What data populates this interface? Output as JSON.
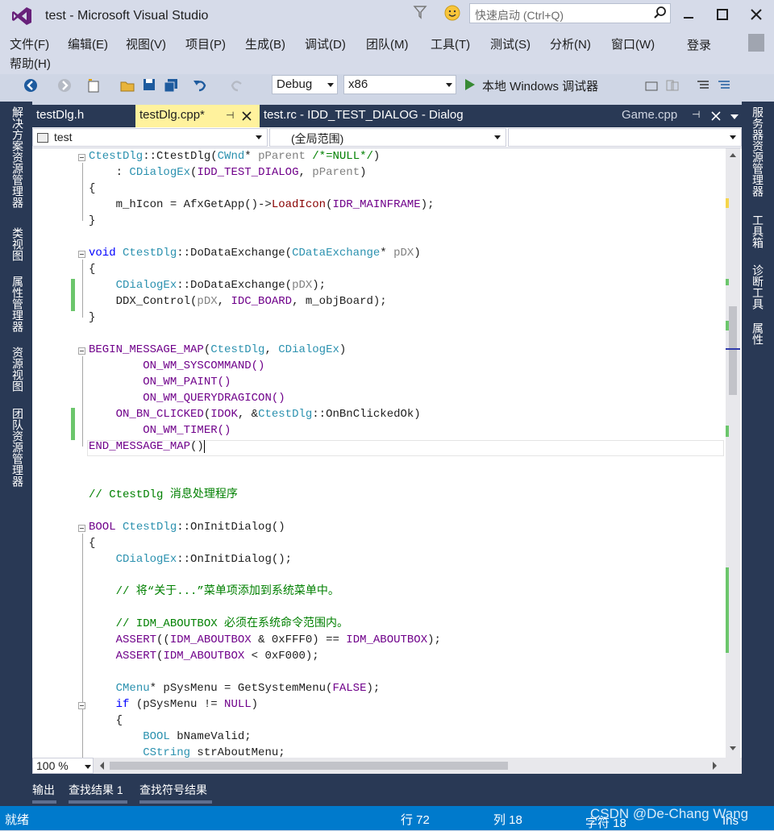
{
  "window": {
    "title": "test - Microsoft Visual Studio",
    "quick_launch_placeholder": "快速启动 (Ctrl+Q)",
    "login": "登录"
  },
  "menu": [
    "文件(F)",
    "编辑(E)",
    "视图(V)",
    "项目(P)",
    "生成(B)",
    "调试(D)",
    "团队(M)",
    "工具(T)",
    "测试(S)",
    "分析(N)",
    "窗口(W)",
    "帮助(H)"
  ],
  "toolbar": {
    "config": "Debug",
    "platform": "x86",
    "debugger": "本地 Windows 调试器"
  },
  "left_rail": [
    "解决方案资源管理器",
    "类视图",
    "属性管理器",
    "资源视图",
    "团队资源管理器"
  ],
  "right_rail": [
    "服务器资源管理器",
    "工具箱",
    "诊断工具",
    "属性"
  ],
  "tabs": [
    "testDlg.h",
    "testDlg.cpp*",
    "test.rc - IDD_TEST_DIALOG - Dialog",
    "Game.cpp"
  ],
  "nav": {
    "project": "test",
    "scope": "(全局范围)",
    "member": ""
  },
  "zoom": "100 %",
  "bottom_tabs": [
    "输出",
    "查找结果 1",
    "查找符号结果"
  ],
  "status": {
    "ready": "就绪",
    "line": "行 72",
    "col": "列 18",
    "char": "字符 18",
    "mode": "Ins",
    "watermark": "CSDN @De-Chang Wang"
  },
  "code": [
    "CtestDlg::CtestDlg(CWnd* pParent /*=NULL*/)",
    "    : CDialogEx(IDD_TEST_DIALOG, pParent)",
    "{",
    "    m_hIcon = AfxGetApp()->LoadIcon(IDR_MAINFRAME);",
    "}",
    "",
    "void CtestDlg::DoDataExchange(CDataExchange* pDX)",
    "{",
    "    CDialogEx::DoDataExchange(pDX);",
    "    DDX_Control(pDX, IDC_BOARD, m_objBoard);",
    "}",
    "",
    "BEGIN_MESSAGE_MAP(CtestDlg, CDialogEx)",
    "    ON_WM_SYSCOMMAND()",
    "    ON_WM_PAINT()",
    "    ON_WM_QUERYDRAGICON()",
    "    ON_BN_CLICKED(IDOK, &CtestDlg::OnBnClickedOk)",
    "    ON_WM_TIMER()",
    "END_MESSAGE_MAP()",
    "",
    "",
    "// CtestDlg 消息处理程序",
    "",
    "BOOL CtestDlg::OnInitDialog()",
    "{",
    "    CDialogEx::OnInitDialog();",
    "",
    "    // 将“关于...”菜单项添加到系统菜单中。",
    "",
    "    // IDM_ABOUTBOX 必须在系统命令范围内。",
    "    ASSERT((IDM_ABOUTBOX & 0xFFF0) == IDM_ABOUTBOX);",
    "    ASSERT(IDM_ABOUTBOX < 0xF000);",
    "",
    "    CMenu* pSysMenu = GetSystemMenu(FALSE);",
    "    if (pSysMenu != NULL)",
    "    {",
    "        BOOL bNameValid;",
    "        CString strAboutMenu;"
  ],
  "colors": {
    "accent": "#007ACC",
    "rail": "#293955",
    "active_tab": "#FFF29D"
  }
}
